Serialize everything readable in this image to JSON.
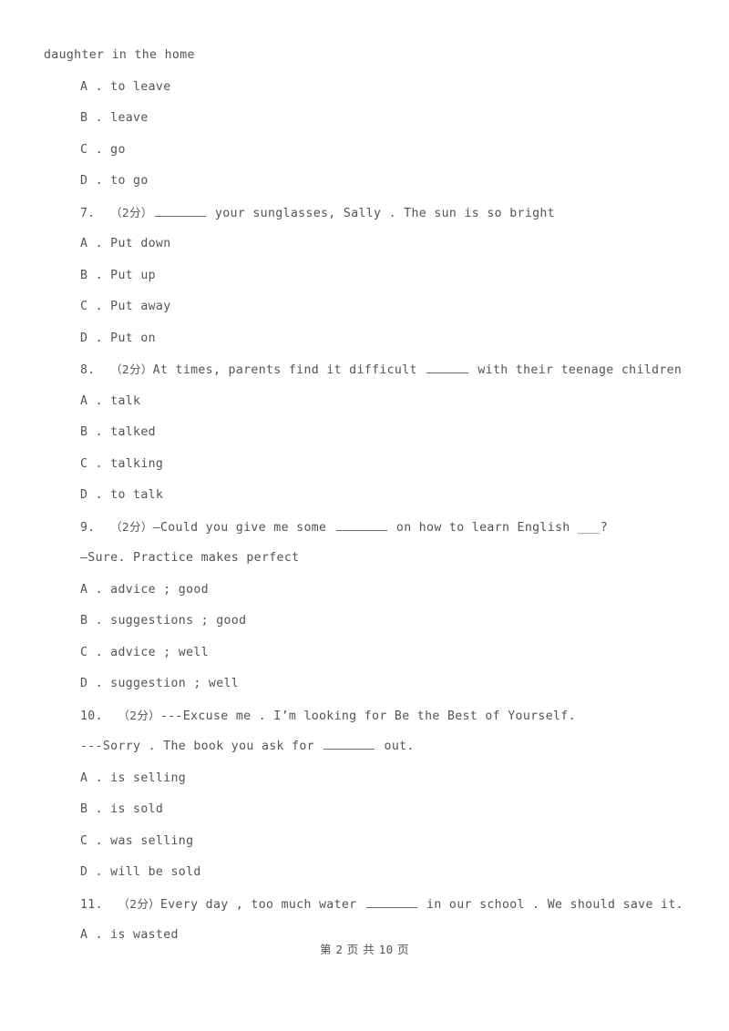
{
  "document": {
    "page_label_prefix": "第",
    "page_number": "2",
    "page_label_middle": "页 共",
    "total_pages": "10",
    "page_label_suffix": "页",
    "footer_text": "第 2 页 共 10 页"
  },
  "content": {
    "continuation_line": "daughter in the home",
    "questions": [
      {
        "number": "7.",
        "points": "（2分）",
        "stem_before_blank": "",
        "stem_after_blank": " your sunglasses, Sally . The sun is so bright",
        "blank_size": "lg",
        "sub_line": "",
        "options": [
          {
            "letter": "A",
            "sep": " . ",
            "text": "Put down"
          },
          {
            "letter": "B",
            "sep": " . ",
            "text": "Put up"
          },
          {
            "letter": "C",
            "sep": " . ",
            "text": "Put away"
          },
          {
            "letter": "D",
            "sep": " . ",
            "text": "Put on"
          }
        ]
      },
      {
        "number": "8.",
        "points": "（2分）",
        "stem_before_blank": "At times, parents find it difficult ",
        "stem_after_blank": " with their teenage children",
        "blank_size": "md",
        "sub_line": "",
        "options": [
          {
            "letter": "A",
            "sep": " . ",
            "text": "talk"
          },
          {
            "letter": "B",
            "sep": " . ",
            "text": "talked"
          },
          {
            "letter": "C",
            "sep": " . ",
            "text": "talking"
          },
          {
            "letter": "D",
            "sep": " . ",
            "text": "to talk"
          }
        ]
      },
      {
        "number": "9.",
        "points": "（2分）",
        "stem_before_blank": "—Could you give me some ",
        "stem_after_blank": " on how to learn English ___?",
        "blank_size": "lg",
        "sub_line": "—Sure. Practice makes perfect",
        "options": [
          {
            "letter": "A",
            "sep": " . ",
            "text": "advice ; good"
          },
          {
            "letter": "B",
            "sep": " . ",
            "text": "suggestions ; good"
          },
          {
            "letter": "C",
            "sep": " . ",
            "text": "advice ; well"
          },
          {
            "letter": "D",
            "sep": " . ",
            "text": "suggestion ; well"
          }
        ]
      },
      {
        "number": "10.",
        "points": "（2分）",
        "stem_before_blank": "---Excuse me . I’m looking for Be the Best of Yourself.",
        "stem_after_blank": "",
        "blank_size": "none",
        "sub_line": "---Sorry . The book you ask for ______ out.",
        "options": [
          {
            "letter": "A",
            "sep": " . ",
            "text": "is selling"
          },
          {
            "letter": "B",
            "sep": " . ",
            "text": "is sold"
          },
          {
            "letter": "C",
            "sep": " . ",
            "text": "was selling"
          },
          {
            "letter": "D",
            "sep": " . ",
            "text": "will be sold"
          }
        ]
      },
      {
        "number": "11.",
        "points": "（2分）",
        "stem_before_blank": "Every day , too much water ",
        "stem_after_blank": " in our school . We should save it.",
        "blank_size": "lg",
        "sub_line": "",
        "options": [
          {
            "letter": "A",
            "sep": " . ",
            "text": "is wasted"
          }
        ]
      }
    ]
  }
}
